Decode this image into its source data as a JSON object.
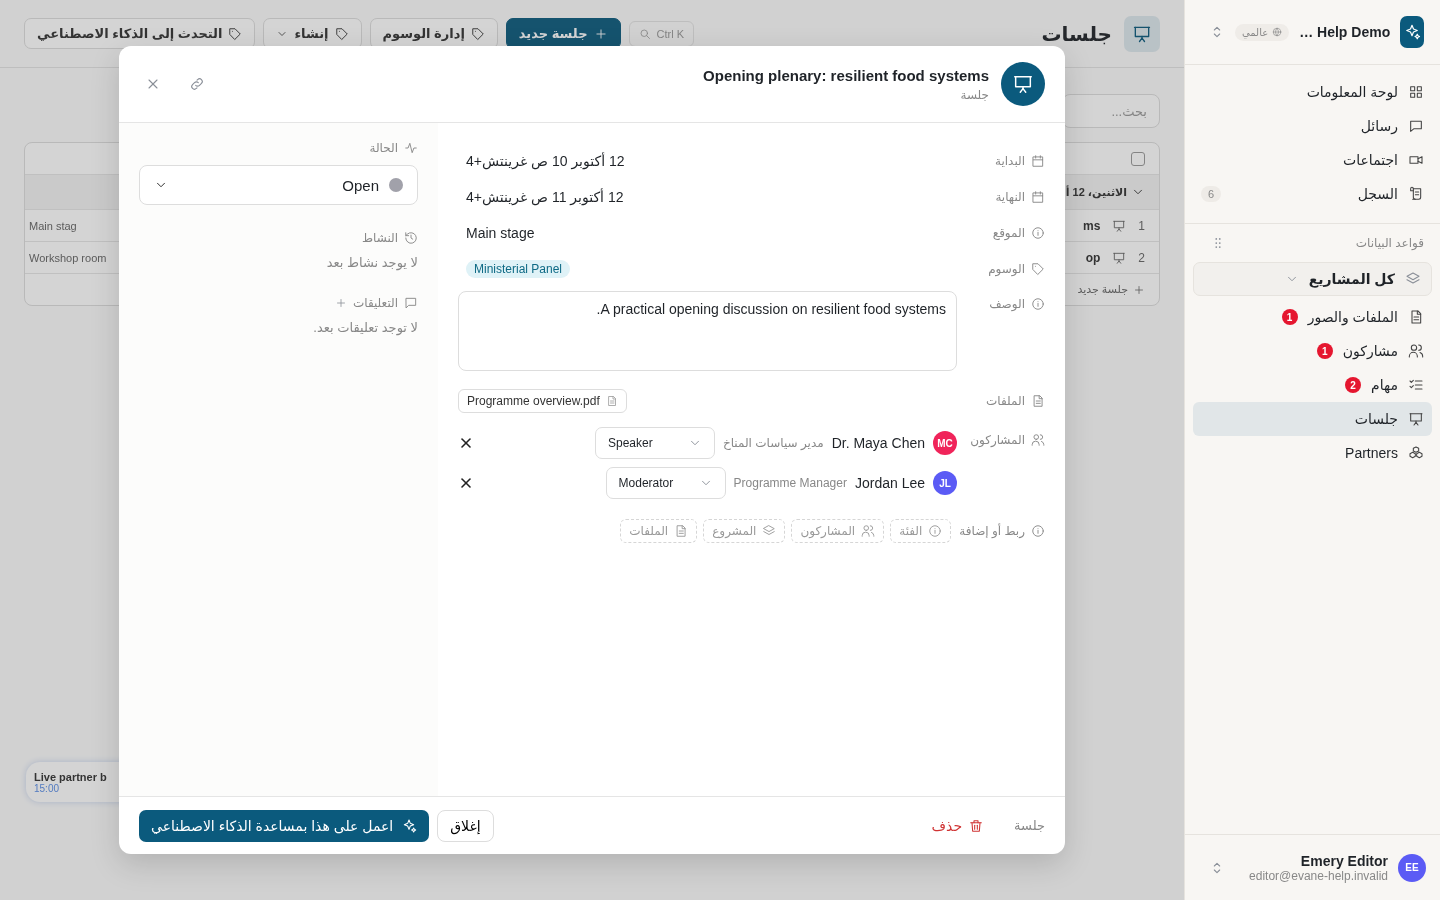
{
  "background": {
    "title": "جلسات",
    "search_shortcut": "Ctrl K",
    "toolbar": [
      {
        "label": "جلسة جديد",
        "kind": "primary"
      },
      {
        "label": "إدارة الوسوم",
        "kind": "plain"
      },
      {
        "label": "إنشاء",
        "kind": "menu"
      },
      {
        "label": "التحدث إلى الذكاء الاصطناعي",
        "kind": "plain"
      }
    ],
    "list_search": {
      "placeholder": "بحث..."
    },
    "table": {
      "select_all_checked": false,
      "group": "الاثنين، 12 أ",
      "rows": [
        {
          "number": "1",
          "title": "ms",
          "location": "Main stag"
        },
        {
          "number": "2",
          "title": "op",
          "location": "Workshop room"
        }
      ],
      "add_row": "جلسة جديد"
    },
    "floating_card": {
      "title": "Live partner b",
      "time": "15:00"
    }
  },
  "sidebar": {
    "workspace": "Help Demo …",
    "scope": "عالمي",
    "nav": [
      {
        "label": "لوحة المعلومات"
      },
      {
        "label": "رسائل"
      },
      {
        "label": "اجتماعات"
      },
      {
        "label": "السجل",
        "count": "6"
      }
    ],
    "section": "قواعد البيانات",
    "project_filter": "كل المشاريع",
    "items": [
      {
        "label": "الملفات والصور",
        "badge": "1",
        "selected": false
      },
      {
        "label": "مشاركون",
        "badge": "1",
        "selected": false
      },
      {
        "label": "مهام",
        "badge": "2",
        "selected": false
      },
      {
        "label": "جلسات",
        "selected": true
      },
      {
        "label": "Partners",
        "selected": false
      }
    ],
    "user": {
      "initials": "EE",
      "name": "Emery Editor",
      "email": "editor@evane-help.invalid"
    }
  },
  "modal": {
    "title": "Opening plenary: resilient food systems",
    "subtitle": "جلسة",
    "fields": [
      {
        "label": "البداية",
        "kind": "text",
        "value": "12 أكتوبر 10 ص غرينتش+4"
      },
      {
        "label": "النهاية",
        "kind": "text",
        "value": "12 أكتوبر 11 ص غرينتش+4"
      },
      {
        "label": "الموقع",
        "kind": "text",
        "value": "Main stage"
      },
      {
        "label": "الوسوم",
        "kind": "tag",
        "value": "Ministerial Panel"
      },
      {
        "label": "الوصف",
        "kind": "textarea",
        "value": "A practical opening discussion on resilient food systems."
      },
      {
        "label": "الملفات",
        "kind": "file",
        "value": "Programme overview.pdf"
      }
    ],
    "participants_label": "المشاركون",
    "participants": [
      {
        "initials": "MC",
        "color": "#f0245a",
        "name": "Dr. Maya Chen",
        "role_title": "مدير سياسات المناخ",
        "role": "Speaker"
      },
      {
        "initials": "JL",
        "color": "#5b5bf5",
        "name": "Jordan Lee",
        "role_title": "Programme Manager",
        "role": "Moderator"
      }
    ],
    "link_label": "ربط أو إضافة",
    "link_chips": [
      "الفئة",
      "المشاركون",
      "المشروع",
      "الملفات"
    ],
    "status": {
      "label": "الحالة",
      "value": "Open",
      "color": "#a1a1aa"
    },
    "activity": {
      "label": "النشاط",
      "empty": "لا يوجد نشاط بعد"
    },
    "comments": {
      "label": "التعليقات",
      "empty": "لا توجد تعليقات بعد."
    },
    "footer": {
      "type_label": "جلسة",
      "delete": "حذف",
      "close": "إغلاق",
      "ai_action": "اعمل على هذا بمساعدة الذكاء الاصطناعي"
    }
  }
}
